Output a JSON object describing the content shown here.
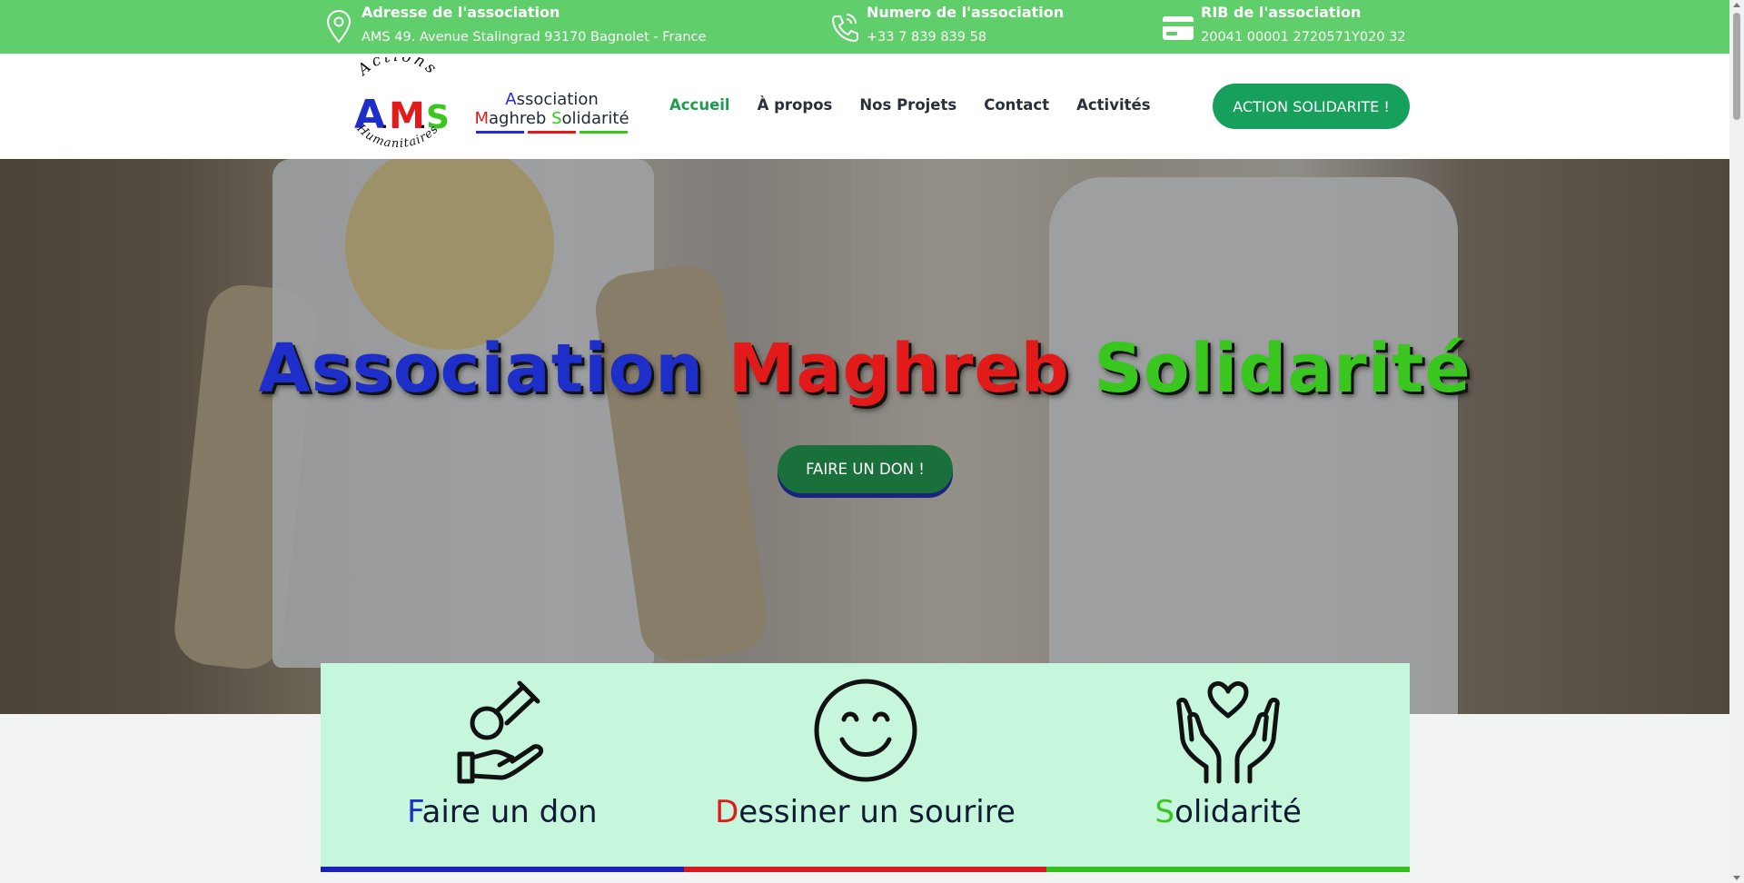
{
  "topbar": {
    "address_title": "Adresse de l'association",
    "address_value": "AMS 49. Avenue Stalingrad 93170 Bagnolet - France",
    "phone_title": "Numero de l'association",
    "phone_value": "+33 7 839 839 58",
    "rib_title": "RIB de l'association",
    "rib_value": "20041 00001 2720571Y020 32"
  },
  "header": {
    "logo": {
      "top": "Actions",
      "a": "A",
      "m": "M",
      "s": "S",
      "bottom": "Humanitaires"
    },
    "brand": {
      "line1_first": "A",
      "line1_rest": "ssociation",
      "line2_m": "M",
      "line2_aghreb": "aghreb ",
      "line2_s": "S",
      "line2_olidarite": "olidarité"
    },
    "nav": [
      "Accueil",
      "À propos",
      "Nos Projets",
      "Contact",
      "Activités"
    ],
    "cta_label": "ACTION SOLIDARITE !"
  },
  "hero": {
    "title_word1": "Association",
    "title_word2": "Maghreb",
    "title_word3": "Solidarité",
    "donate_label": "FAIRE UN DON !"
  },
  "features": [
    {
      "first": "F",
      "rest": "aire un don",
      "icon": "hand-coin-icon",
      "color": "#1d2fc8"
    },
    {
      "first": "D",
      "rest": "essiner un sourire",
      "icon": "smile-icon",
      "color": "#e31a1a"
    },
    {
      "first": "S",
      "rest": "olidarité",
      "icon": "heart-hands-icon",
      "color": "#38c61f"
    }
  ],
  "colors": {
    "topbar": "#5fce6b",
    "accent_green": "#16a05c",
    "blue": "#1d2fc8",
    "red": "#e31a1a",
    "green": "#38c61f",
    "feature_bg": "#c6f7dc"
  }
}
